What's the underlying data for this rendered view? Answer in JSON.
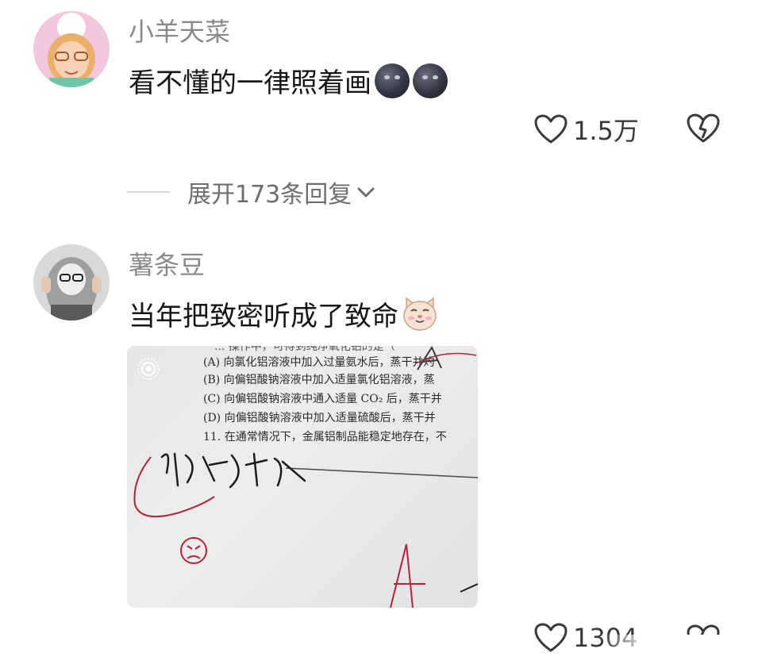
{
  "comments": [
    {
      "username": "小羊天菜",
      "text": "看不懂的一律照着画",
      "emoji": [
        "new-moon-face-emoji",
        "new-moon-face-emoji"
      ],
      "likes": "1.5万",
      "expand_label": "展开173条回复"
    },
    {
      "username": "薯条豆",
      "text": "当年把致密听成了致命",
      "emoji": [
        "cat-face-emoji"
      ],
      "likes": "1304",
      "photo_lines": [
        "(A) 向氯化铝溶液中加入过量氨水后，蒸干并灼",
        "(B) 向偏铝酸钠溶液中加入适量氯化铝溶液，蒸",
        "(C) 向偏铝酸钠溶液中通入适量 CO₂ 后，蒸干并",
        "(D) 向偏铝酸钠溶液中加入适量硫酸后，蒸干并",
        "11. 在通常情况下，金属铝制品能稳定地存在，不"
      ],
      "photo_header": "... 操作中，可得到纯净氧化铝的是（",
      "handwriting": "致命氧化膜"
    }
  ],
  "colors": {
    "username": "#8a8a8a",
    "text": "#161616",
    "muted": "#6e6e6e",
    "ink_red": "#b0243a"
  }
}
